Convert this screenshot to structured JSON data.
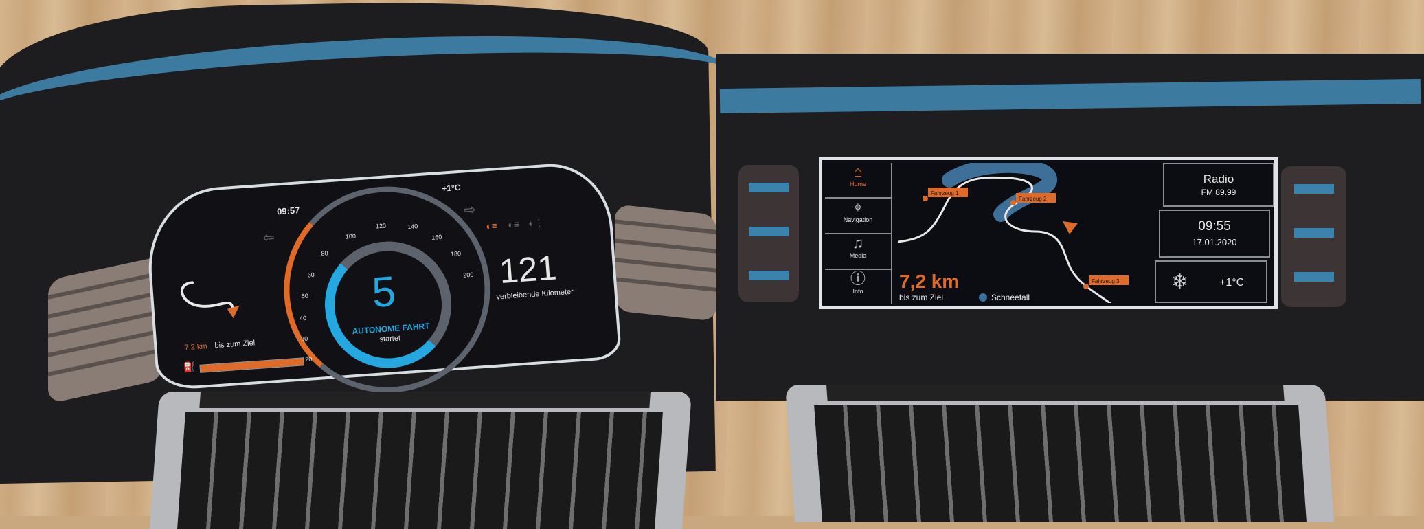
{
  "cluster": {
    "time": "09:57",
    "temperature": "+1°C",
    "speed_ticks": [
      "20",
      "30",
      "40",
      "50",
      "60",
      "80",
      "100",
      "120",
      "140",
      "160",
      "180",
      "200"
    ],
    "speed_display": "5",
    "status_line1": "AUTONOME FAHRT",
    "status_line2": "startet",
    "range_value": "121",
    "range_label": "verbleibende Kilometer",
    "distance_value": "7,2 km",
    "distance_label": "bis zum Ziel",
    "icons": [
      "arrow-left-icon",
      "arrow-right-icon",
      "headlight-icon",
      "low-beam-icon",
      "fog-light-icon",
      "fuel-icon"
    ]
  },
  "infotainment": {
    "nav": [
      {
        "label": "Home",
        "icon": "home-icon",
        "active": true
      },
      {
        "label": "Navigation",
        "icon": "location-icon",
        "active": false
      },
      {
        "label": "Media",
        "icon": "music-icon",
        "active": false
      },
      {
        "label": "Info",
        "icon": "info-icon",
        "active": false
      }
    ],
    "map": {
      "vehicle_labels": [
        "Fahrzeug 1",
        "Fahrzeug 2",
        "Fahrzeug 3"
      ],
      "distance_value": "7,2 km",
      "distance_label": "bis zum Ziel",
      "weather_label": "Schneefall"
    },
    "radio": {
      "title": "Radio",
      "station": "FM 89.99"
    },
    "clock": {
      "time": "09:55",
      "date": "17.01.2020"
    },
    "weather": {
      "temperature": "+1°C",
      "icon": "snowflake-icon"
    }
  },
  "colors": {
    "accent_orange": "#e06a28",
    "accent_blue": "#25a7df",
    "stripe_blue": "#3d7aa0"
  }
}
